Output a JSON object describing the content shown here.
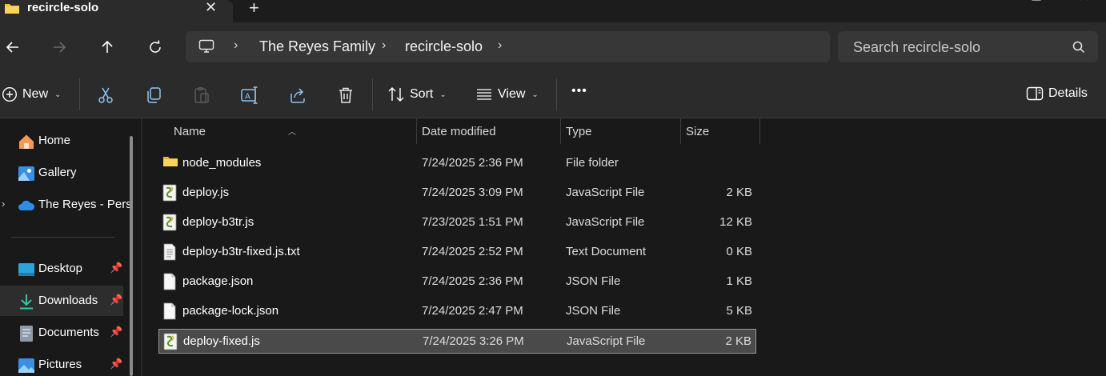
{
  "window": {
    "tab_title": "recircle-solo",
    "close_glyph": "✕",
    "new_tab_glyph": "+"
  },
  "address": {
    "crumbs": [
      "The Reyes Family",
      "recircle-solo"
    ],
    "search_placeholder": "Search recircle-solo"
  },
  "toolbar": {
    "new_label": "New",
    "sort_label": "Sort",
    "view_label": "View",
    "more_label": "•••",
    "details_label": "Details",
    "icons": [
      "cut-icon",
      "copy-icon",
      "paste-icon",
      "rename-icon",
      "share-icon",
      "delete-icon"
    ]
  },
  "nav": {
    "items": [
      {
        "label": "Home",
        "icon": "home-icon",
        "pinned": false
      },
      {
        "label": "Gallery",
        "icon": "gallery-icon",
        "pinned": false
      },
      {
        "label": "The Reyes - Pers",
        "icon": "onedrive-icon",
        "pinned": false
      },
      {
        "label": "Desktop",
        "icon": "desktop-icon",
        "pinned": true
      },
      {
        "label": "Downloads",
        "icon": "downloads-icon",
        "pinned": true
      },
      {
        "label": "Documents",
        "icon": "documents-icon",
        "pinned": true
      },
      {
        "label": "Pictures",
        "icon": "pictures-icon",
        "pinned": true
      }
    ],
    "selected": "Downloads"
  },
  "columns": {
    "name": "Name",
    "date": "Date modified",
    "type": "Type",
    "size": "Size"
  },
  "files": [
    {
      "name": "node_modules",
      "date": "7/24/2025 2:36 PM",
      "type": "File folder",
      "size": "",
      "icon": "folder-icon"
    },
    {
      "name": "deploy.js",
      "date": "7/24/2025 3:09 PM",
      "type": "JavaScript File",
      "size": "2 KB",
      "icon": "js-file-icon"
    },
    {
      "name": "deploy-b3tr.js",
      "date": "7/23/2025 1:51 PM",
      "type": "JavaScript File",
      "size": "12 KB",
      "icon": "js-file-icon"
    },
    {
      "name": "deploy-b3tr-fixed.js.txt",
      "date": "7/24/2025 2:52 PM",
      "type": "Text Document",
      "size": "0 KB",
      "icon": "text-file-icon"
    },
    {
      "name": "package.json",
      "date": "7/24/2025 2:36 PM",
      "type": "JSON File",
      "size": "1 KB",
      "icon": "blank-file-icon"
    },
    {
      "name": "package-lock.json",
      "date": "7/24/2025 2:47 PM",
      "type": "JSON File",
      "size": "5 KB",
      "icon": "blank-file-icon"
    },
    {
      "name": "deploy-fixed.js",
      "date": "7/24/2025 3:26 PM",
      "type": "JavaScript File",
      "size": "2 KB",
      "icon": "js-file-icon"
    }
  ],
  "selected_file": "deploy-fixed.js"
}
